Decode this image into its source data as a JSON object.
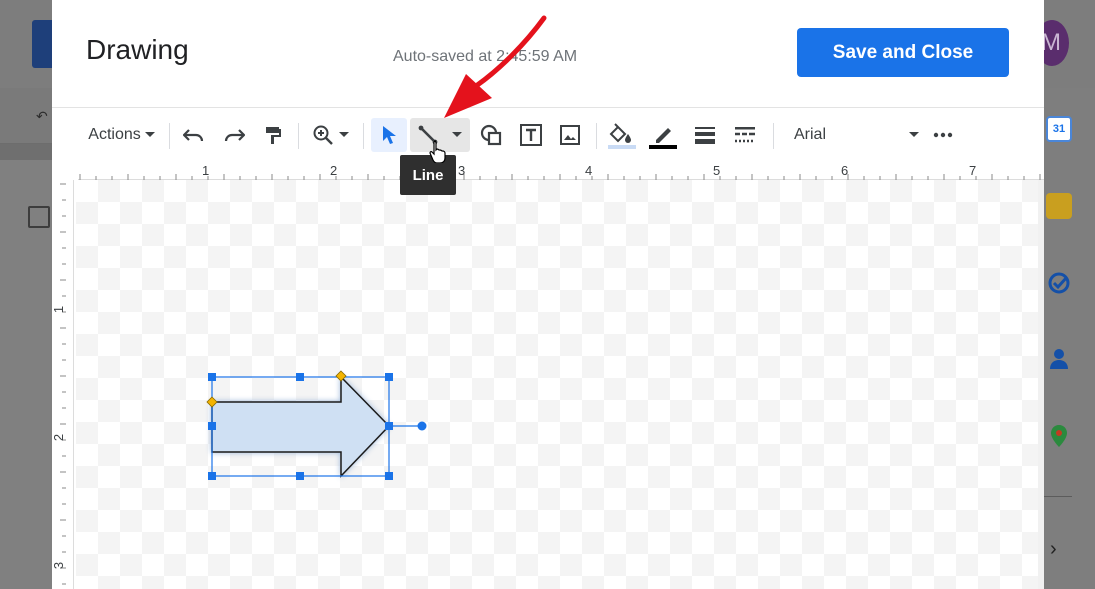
{
  "background": {
    "avatar_letter": "M",
    "side_panel": [
      {
        "name": "calendar-icon",
        "text": "31",
        "color": "#1a73e8"
      },
      {
        "name": "keep-icon",
        "text": "",
        "color": "#f6bf26"
      },
      {
        "name": "tasks-icon",
        "text": "",
        "color": "#1a73e8"
      },
      {
        "name": "contacts-icon",
        "text": "",
        "color": "#1a73e8"
      },
      {
        "name": "maps-icon",
        "text": "",
        "color": "#34a853"
      }
    ]
  },
  "dialog": {
    "title": "Drawing",
    "autosave": "Auto-saved at 2:45:59 AM",
    "save_button": "Save and Close"
  },
  "toolbar": {
    "actions_label": "Actions",
    "font_name": "Arial",
    "fill_color": "#c9dbf5",
    "line_color": "#000000"
  },
  "tooltip": {
    "text": "Line"
  },
  "rulers": {
    "top": [
      "1",
      "2",
      "3",
      "4",
      "5",
      "6",
      "7"
    ],
    "left": [
      "1",
      "2",
      "3"
    ]
  },
  "colors": {
    "accent": "#1a73e8",
    "shape_fill": "#cfe0f3",
    "handle": "#1a73e8",
    "adjust_handle": "#f4b400",
    "arrow_annotation": "#e4121c"
  }
}
